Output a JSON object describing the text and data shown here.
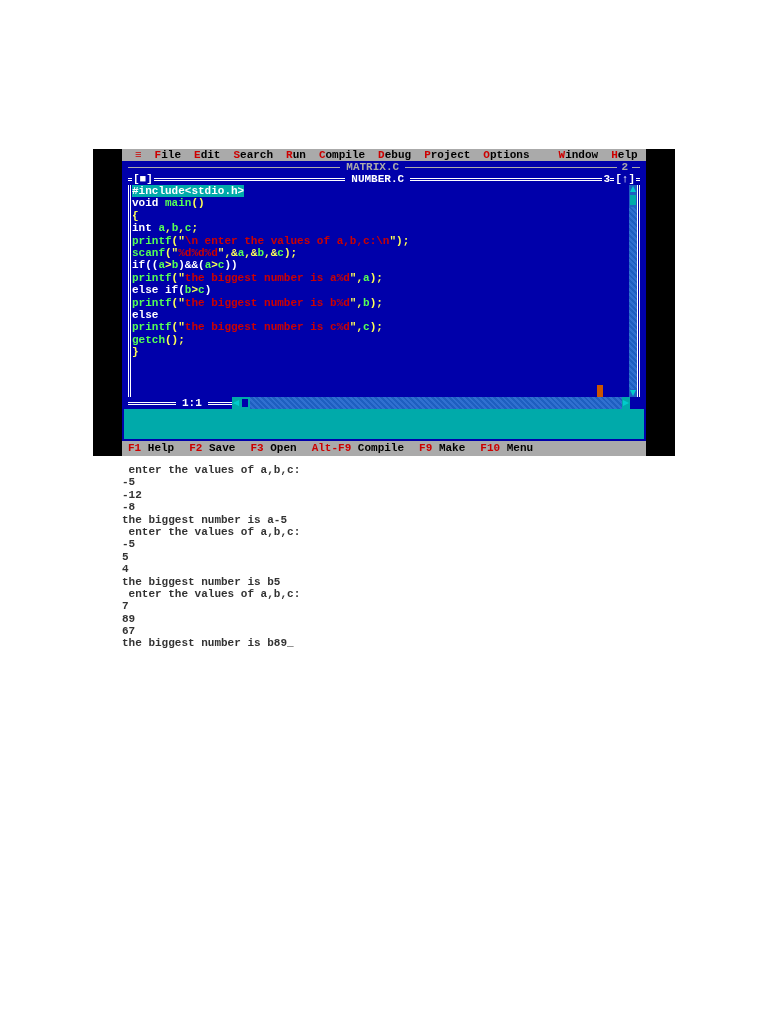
{
  "menu": [
    {
      "label": "≡"
    },
    {
      "label": "File"
    },
    {
      "label": "Edit"
    },
    {
      "label": "Search"
    },
    {
      "label": "Run"
    },
    {
      "label": "Compile"
    },
    {
      "label": "Debug"
    },
    {
      "label": "Project"
    },
    {
      "label": "Options"
    },
    {
      "label": "Window"
    },
    {
      "label": "Help"
    }
  ],
  "back_window": {
    "title": "MATRIX.C",
    "number": "2"
  },
  "editor": {
    "close_box": "[■]",
    "title": "NUMBER.C",
    "number": "3",
    "zoom_box": "[↑]",
    "position": "1:1",
    "lines": [
      {
        "selected": true,
        "segments": [
          {
            "text": "#include<stdio.h>",
            "kind": "preproc"
          }
        ]
      },
      {
        "selected": false,
        "segments": [
          {
            "text": "void ",
            "kind": "keyword"
          },
          {
            "text": "main",
            "kind": "ident"
          },
          {
            "text": "()",
            "kind": "symbol"
          }
        ]
      },
      {
        "selected": false,
        "segments": [
          {
            "text": "{",
            "kind": "symbol"
          }
        ]
      },
      {
        "selected": false,
        "segments": [
          {
            "text": "int ",
            "kind": "keyword"
          },
          {
            "text": "a",
            "kind": "ident"
          },
          {
            "text": ",",
            "kind": "symbol"
          },
          {
            "text": "b",
            "kind": "ident"
          },
          {
            "text": ",",
            "kind": "symbol"
          },
          {
            "text": "c",
            "kind": "ident"
          },
          {
            "text": ";",
            "kind": "symbol"
          }
        ]
      },
      {
        "selected": false,
        "segments": [
          {
            "text": "printf",
            "kind": "ident"
          },
          {
            "text": "(\"",
            "kind": "symbol"
          },
          {
            "text": "\\n enter the values of a,b,c:\\n",
            "kind": "string"
          },
          {
            "text": "\");",
            "kind": "symbol"
          }
        ]
      },
      {
        "selected": false,
        "segments": [
          {
            "text": "scanf",
            "kind": "ident"
          },
          {
            "text": "(\"",
            "kind": "symbol"
          },
          {
            "text": "%d%d%d",
            "kind": "string"
          },
          {
            "text": "\",&",
            "kind": "symbol"
          },
          {
            "text": "a",
            "kind": "ident"
          },
          {
            "text": ",&",
            "kind": "symbol"
          },
          {
            "text": "b",
            "kind": "ident"
          },
          {
            "text": ",&",
            "kind": "symbol"
          },
          {
            "text": "c",
            "kind": "ident"
          },
          {
            "text": ");",
            "kind": "symbol"
          }
        ]
      },
      {
        "selected": false,
        "segments": [
          {
            "text": "if((",
            "kind": "keyword"
          },
          {
            "text": "a",
            "kind": "ident"
          },
          {
            "text": ">",
            "kind": "symbol"
          },
          {
            "text": "b",
            "kind": "ident"
          },
          {
            "text": ")&&(",
            "kind": "keyword"
          },
          {
            "text": "a",
            "kind": "ident"
          },
          {
            "text": ">",
            "kind": "symbol"
          },
          {
            "text": "c",
            "kind": "ident"
          },
          {
            "text": "))",
            "kind": "keyword"
          }
        ]
      },
      {
        "selected": false,
        "segments": [
          {
            "text": "printf",
            "kind": "ident"
          },
          {
            "text": "(\"",
            "kind": "symbol"
          },
          {
            "text": "the biggest number is a%d",
            "kind": "string"
          },
          {
            "text": "\",",
            "kind": "symbol"
          },
          {
            "text": "a",
            "kind": "ident"
          },
          {
            "text": ");",
            "kind": "symbol"
          }
        ]
      },
      {
        "selected": false,
        "segments": [
          {
            "text": "else if(",
            "kind": "keyword"
          },
          {
            "text": "b",
            "kind": "ident"
          },
          {
            "text": ">",
            "kind": "symbol"
          },
          {
            "text": "c",
            "kind": "ident"
          },
          {
            "text": ")",
            "kind": "keyword"
          }
        ]
      },
      {
        "selected": false,
        "segments": [
          {
            "text": "printf",
            "kind": "ident"
          },
          {
            "text": "(\"",
            "kind": "symbol"
          },
          {
            "text": "the biggest number is b%d",
            "kind": "string"
          },
          {
            "text": "\",",
            "kind": "symbol"
          },
          {
            "text": "b",
            "kind": "ident"
          },
          {
            "text": ");",
            "kind": "symbol"
          }
        ]
      },
      {
        "selected": false,
        "segments": [
          {
            "text": "else",
            "kind": "keyword"
          }
        ]
      },
      {
        "selected": false,
        "segments": [
          {
            "text": "printf",
            "kind": "ident"
          },
          {
            "text": "(\"",
            "kind": "symbol"
          },
          {
            "text": "the biggest number is c%d",
            "kind": "string"
          },
          {
            "text": "\",",
            "kind": "symbol"
          },
          {
            "text": "c",
            "kind": "ident"
          },
          {
            "text": ");",
            "kind": "symbol"
          }
        ]
      },
      {
        "selected": false,
        "segments": [
          {
            "text": "getch",
            "kind": "ident"
          },
          {
            "text": "();",
            "kind": "symbol"
          }
        ]
      },
      {
        "selected": false,
        "segments": [
          {
            "text": "}",
            "kind": "symbol"
          }
        ]
      }
    ]
  },
  "status_bar": [
    {
      "key": "F1",
      "label": "Help"
    },
    {
      "key": "F2",
      "label": "Save"
    },
    {
      "key": "F3",
      "label": "Open"
    },
    {
      "key": "Alt-F9",
      "label": "Compile"
    },
    {
      "key": "F9",
      "label": "Make"
    },
    {
      "key": "F10",
      "label": "Menu"
    }
  ],
  "output": [
    " enter the values of a,b,c:",
    "-5",
    "-12",
    "-8",
    "the biggest number is a-5",
    " enter the values of a,b,c:",
    "-5",
    "5",
    "4",
    "the biggest number is b5",
    " enter the values of a,b,c:",
    "7",
    "89",
    "67",
    "the biggest number is b89_"
  ]
}
